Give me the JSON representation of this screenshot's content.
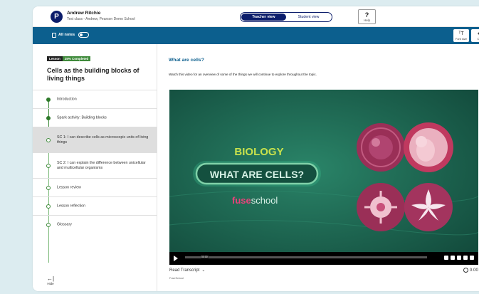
{
  "header": {
    "logo_letter": "P",
    "user_name": "Andrew Ritchie",
    "user_class": "Test class - Andrew, Pearson Demo School",
    "teacher_view": "Teacher view",
    "student_view": "Student view",
    "help_symbol": "?",
    "help_label": "Help"
  },
  "toolbar": {
    "notes_label": "All notes",
    "notes_toggle_on": false,
    "font_size_label": "Font size",
    "font_size_glyph": "ᵀT",
    "contrast_label": "Co"
  },
  "sidebar": {
    "badge_lesson": "Lesson",
    "badge_progress": "25% Completed",
    "progress_percent": 25,
    "lesson_title": "Cells as the building blocks of living things",
    "steps": [
      {
        "label": "Introduction",
        "done": true,
        "active": false
      },
      {
        "label": "Spark activity: Building blocks",
        "done": true,
        "active": false
      },
      {
        "label": "SC 1: I can describe cells as microscopic units of living things",
        "done": false,
        "active": true
      },
      {
        "label": "SC 2: I can explain the difference between unicellular and multicellular organisms",
        "done": false,
        "active": false
      },
      {
        "label": "Lesson review",
        "done": false,
        "active": false
      },
      {
        "label": "Lesson reflection",
        "done": false,
        "active": false
      },
      {
        "label": "Glossary",
        "done": false,
        "active": false
      }
    ],
    "hide_label": "Hide"
  },
  "content": {
    "title": "What are cells?",
    "intro": "Watch this video for an overview of some of the things we will continue to explore throughout the topic.",
    "video": {
      "subject": "BIOLOGY",
      "headline": "WHAT ARE CELLS?",
      "brand_fuse": "fuse",
      "brand_school": "school",
      "timestamp": "00:00",
      "bg_color": "#1c6753",
      "accent_color": "#7fd1a8"
    },
    "transcript_label": "Read Transcript",
    "duration": "0.00",
    "credit": "FuseSchool"
  },
  "colors": {
    "brand_navy": "#0c1d6b",
    "toolbar_blue": "#0c5f8e",
    "progress_green": "#3e8a3a"
  }
}
